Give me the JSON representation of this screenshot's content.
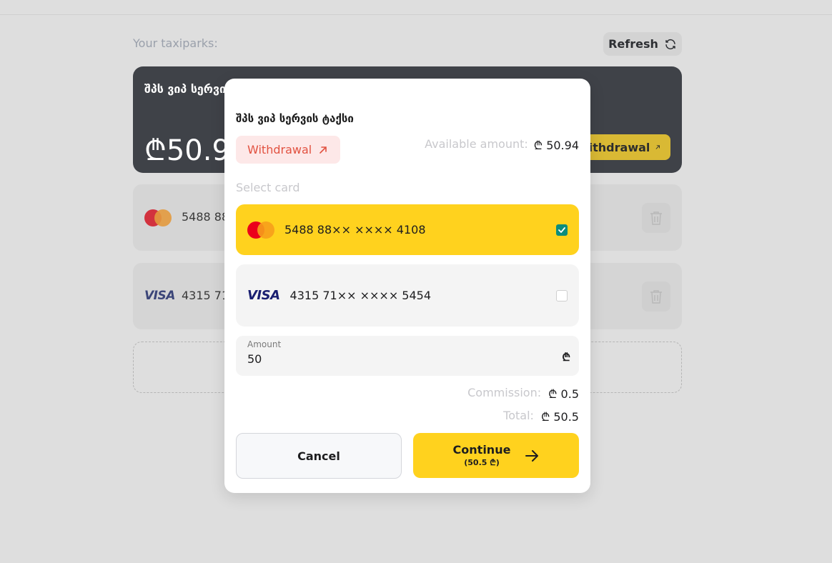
{
  "background": {
    "section_title": "Your taxiparks:",
    "refresh_label": "Refresh",
    "park": {
      "name": "შპს ვიპ სერვის ტაქსი",
      "balance": "₾50.94",
      "withdraw_label": "Withdrawal"
    },
    "cards": [
      {
        "brand": "mastercard",
        "number": "5488 88××"
      },
      {
        "brand": "visa",
        "logo_text": "VISA",
        "number": "4315 71××"
      }
    ]
  },
  "modal": {
    "title": "შპს ვიპ სერვის ტაქსი",
    "withdrawal_badge": "Withdrawal",
    "available_label": "Available amount:",
    "available_value": "₾ 50.94",
    "select_card_label": "Select card",
    "cards": [
      {
        "brand": "mastercard",
        "number": "5488 88×× ×××× 4108",
        "selected": true
      },
      {
        "brand": "visa",
        "logo_text": "VISA",
        "number": "4315 71×× ×××× 5454",
        "selected": false
      }
    ],
    "amount": {
      "label": "Amount",
      "value": "50",
      "currency": "₾"
    },
    "commission_label": "Commission:",
    "commission_value": "₾ 0.5",
    "total_label": "Total:",
    "total_value": "₾ 50.5",
    "cancel_label": "Cancel",
    "continue_label": "Continue",
    "continue_sub": "(50.5 ₾)"
  },
  "colors": {
    "accent_yellow": "#ffd21e",
    "dark_card": "#3f4248",
    "withdraw_red": "#e25241",
    "check_green": "#0c8d7c"
  }
}
